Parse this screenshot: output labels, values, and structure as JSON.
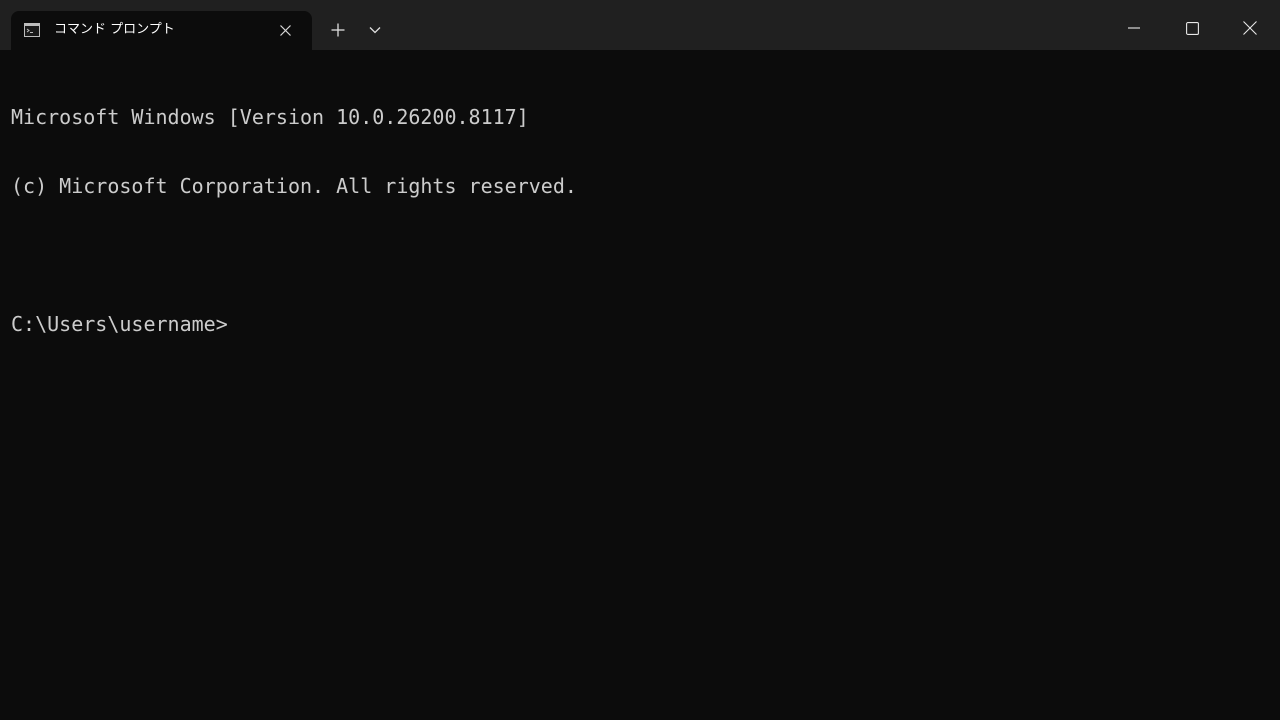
{
  "tab": {
    "title": "コマンド プロンプト",
    "icon": "command-prompt-icon"
  },
  "toolbar": {
    "new_tab_icon": "plus-icon",
    "dropdown_icon": "chevron-down-icon"
  },
  "window_controls": {
    "minimize_icon": "minimize-icon",
    "maximize_icon": "maximize-icon",
    "close_icon": "close-icon"
  },
  "terminal": {
    "lines": [
      "Microsoft Windows [Version 10.0.26200.8117]",
      "(c) Microsoft Corporation. All rights reserved.",
      "",
      "C:\\Users\\username>"
    ]
  },
  "colors": {
    "titlebar_bg": "#202020",
    "terminal_bg": "#0c0c0c",
    "terminal_fg": "#cccccc"
  }
}
